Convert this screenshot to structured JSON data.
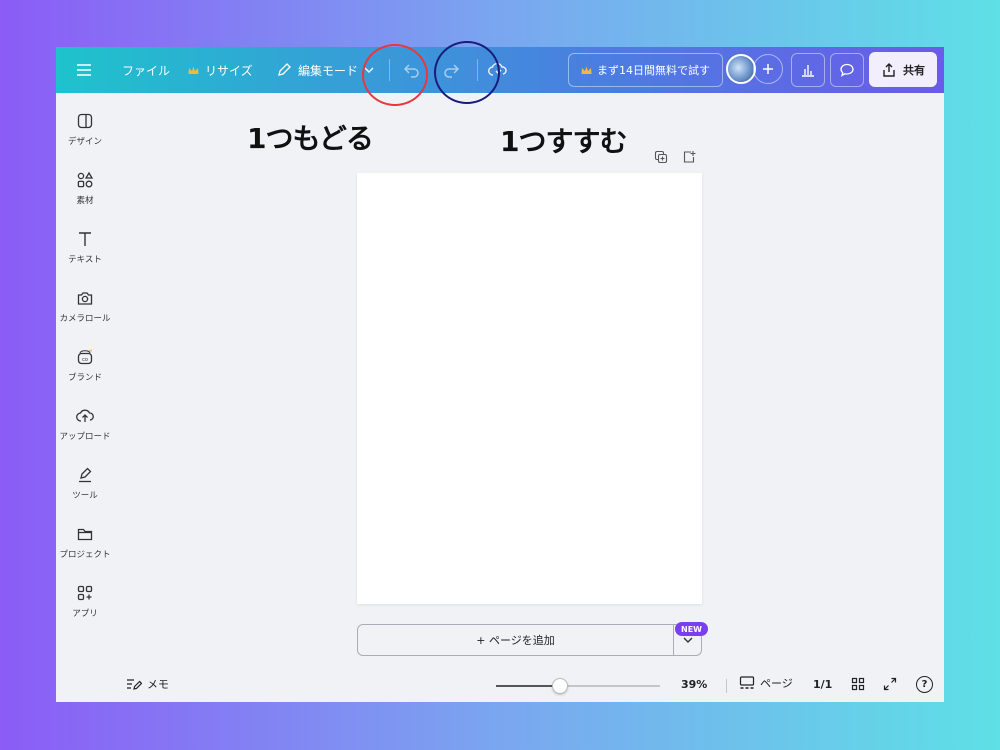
{
  "topbar": {
    "file_label": "ファイル",
    "resize_label": "リサイズ",
    "edit_mode_label": "編集モード",
    "trial_label": "まず14日間無料で試す",
    "share_label": "共有",
    "accent_crown": "#f5b93a"
  },
  "sidebar": {
    "items": [
      {
        "label": "デザイン",
        "icon": "design-icon"
      },
      {
        "label": "素材",
        "icon": "elements-icon"
      },
      {
        "label": "テキスト",
        "icon": "text-icon"
      },
      {
        "label": "カメラロール",
        "icon": "camera-icon"
      },
      {
        "label": "ブランド",
        "icon": "brand-icon"
      },
      {
        "label": "アップロード",
        "icon": "upload-icon"
      },
      {
        "label": "ツール",
        "icon": "tools-icon"
      },
      {
        "label": "プロジェクト",
        "icon": "folder-icon"
      },
      {
        "label": "アプリ",
        "icon": "apps-icon"
      }
    ]
  },
  "canvas": {
    "add_page_label": "+ ページを追加",
    "new_badge": "NEW"
  },
  "bottombar": {
    "memo_label": "メモ",
    "zoom_value": 0.39,
    "zoom_text": "39%",
    "pages_label": "ページ",
    "page_count": "1/1",
    "help_label": "?"
  },
  "annotations": {
    "undo_text": "1つもどる",
    "redo_text": "1つすすむ",
    "undo_color": "#e8383a",
    "redo_color": "#1b1b7a"
  }
}
